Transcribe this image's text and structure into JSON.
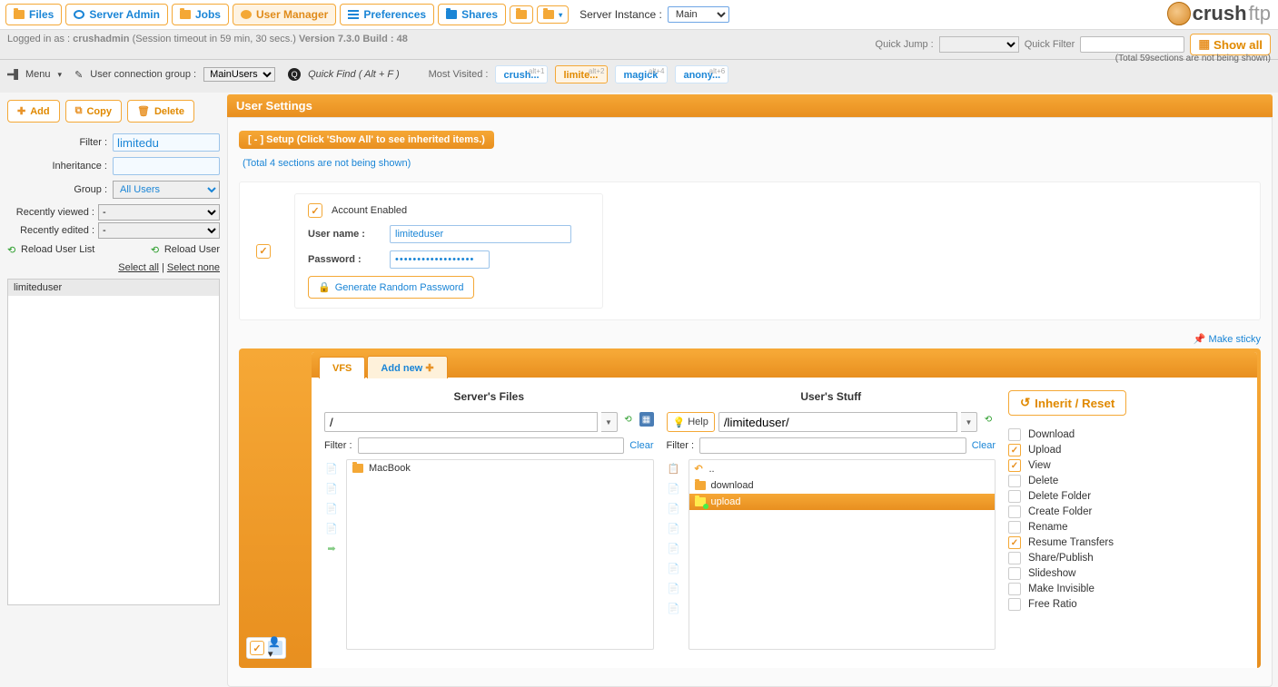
{
  "nav": {
    "tabs": [
      {
        "label": "Files"
      },
      {
        "label": "Server Admin"
      },
      {
        "label": "Jobs"
      },
      {
        "label": "User Manager"
      },
      {
        "label": "Preferences"
      },
      {
        "label": "Shares"
      }
    ],
    "server_instance_label": "Server Instance :",
    "server_instance_value": "Main",
    "brand_bold": "crush",
    "brand_light": "ftp"
  },
  "status": {
    "logged_in": "Logged in as : ",
    "user": "crushadmin",
    "timeout": "  (Session timeout in 59 min, 30 secs.)  ",
    "version": "Version 7.3.0 Build : 48",
    "quick_jump": "Quick Jump :",
    "quick_filter": "Quick Filter",
    "show_all": "Show all",
    "sections_note": "(Total 59sections are not being shown)"
  },
  "menubar": {
    "menu": "Menu",
    "conn_group": "User connection group :",
    "conn_group_val": "MainUsers",
    "quick_find": "Quick Find ( Alt + F )",
    "most_visited": "Most Visited :",
    "mv": [
      {
        "label": "crush...",
        "alt": "alt+1"
      },
      {
        "label": "limite...",
        "alt": "alt+2"
      },
      {
        "label": "magick",
        "alt": "alt+4"
      },
      {
        "label": "anony...",
        "alt": "alt+6"
      }
    ]
  },
  "sidebar": {
    "add": "Add",
    "copy": "Copy",
    "delete": "Delete",
    "filter": "Filter :",
    "filter_val": "limitedu",
    "inheritance": "Inheritance :",
    "group": "Group :",
    "group_val": "All Users",
    "recent_viewed": "Recently viewed :",
    "recent_viewed_val": "-",
    "recent_edited": "Recently edited :",
    "recent_edited_val": "-",
    "reload_list": "Reload User List",
    "reload_user": "Reload User",
    "select_all": "Select all",
    "select_none": "Select none",
    "users": [
      "limiteduser"
    ]
  },
  "settings": {
    "title": "User Settings",
    "setup_chip": "[ - ] Setup (Click 'Show All' to see inherited items.)",
    "hidden_note": "(Total 4 sections are not being shown)",
    "account_enabled": "Account Enabled",
    "username_label": "User name :",
    "username_val": "limiteduser",
    "password_label": "Password :",
    "password_val": "••••••••••••••••••",
    "gen_pw": "Generate Random Password",
    "make_sticky": "Make sticky"
  },
  "vfs": {
    "tab_vfs": "VFS",
    "tab_add": "Add new",
    "server_files": "Server's Files",
    "user_stuff": "User's Stuff",
    "path_server": "/",
    "path_user": "/limiteduser/",
    "filter": "Filter :",
    "clear": "Clear",
    "help": "Help",
    "inherit": "Inherit / Reset",
    "server_items": [
      "..",
      " MacBook"
    ],
    "user_items": [
      "..",
      "download",
      "upload"
    ],
    "perms": [
      {
        "label": "Download",
        "on": false
      },
      {
        "label": "Upload",
        "on": true
      },
      {
        "label": "View",
        "on": true
      },
      {
        "label": "Delete",
        "on": false
      },
      {
        "label": "Delete Folder",
        "on": false
      },
      {
        "label": "Create Folder",
        "on": false
      },
      {
        "label": "Rename",
        "on": false
      },
      {
        "label": "Resume Transfers",
        "on": true
      },
      {
        "label": "Share/Publish",
        "on": false
      },
      {
        "label": "Slideshow",
        "on": false
      },
      {
        "label": "Make Invisible",
        "on": false
      },
      {
        "label": "Free Ratio",
        "on": false
      }
    ]
  }
}
